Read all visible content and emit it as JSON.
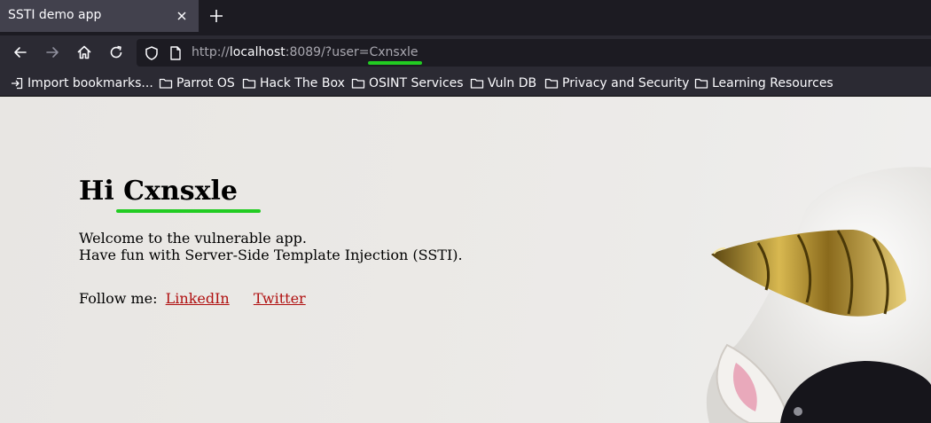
{
  "tab": {
    "title": "SSTI demo app"
  },
  "nav": {
    "url_scheme": "http://",
    "url_host": "localhost",
    "url_rest": ":8089/?user=Cxnsxle"
  },
  "bookmarks": [
    {
      "label": "Import bookmarks...",
      "icon": "import-icon"
    },
    {
      "label": "Parrot OS",
      "icon": "folder-icon"
    },
    {
      "label": "Hack The Box",
      "icon": "folder-icon"
    },
    {
      "label": "OSINT Services",
      "icon": "folder-icon"
    },
    {
      "label": "Vuln DB",
      "icon": "folder-icon"
    },
    {
      "label": "Privacy and Security",
      "icon": "folder-icon"
    },
    {
      "label": "Learning Resources",
      "icon": "folder-icon"
    }
  ],
  "page": {
    "greeting": "Hi Cxnsxle",
    "welcome_line1": "Welcome to the vulnerable app.",
    "welcome_line2": "Have fun with Server-Side Template Injection (SSTI).",
    "follow_label": "Follow me:",
    "link_linkedin": "LinkedIn",
    "link_twitter": "Twitter"
  },
  "colors": {
    "highlight": "#22cc22",
    "link": "#b01010",
    "chrome_dark": "#1c1b22",
    "chrome": "#2b2a33"
  }
}
